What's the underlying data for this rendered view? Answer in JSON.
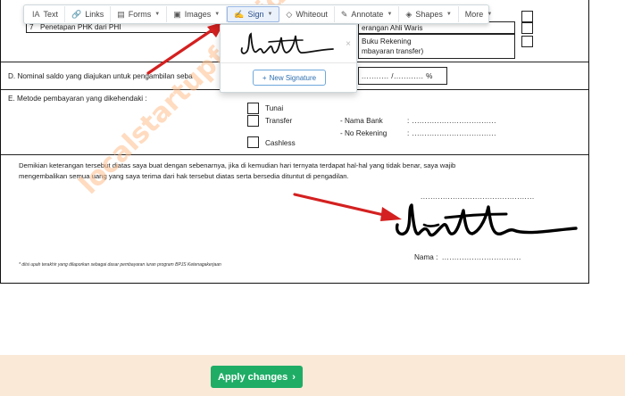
{
  "toolbar": {
    "items": [
      {
        "icon": "text-icon",
        "glyph": "IA",
        "label": "Text",
        "dropdown": false
      },
      {
        "icon": "link-icon",
        "glyph": "🔗",
        "label": "Links",
        "dropdown": false
      },
      {
        "icon": "forms-icon",
        "glyph": "▤",
        "label": "Forms",
        "dropdown": true
      },
      {
        "icon": "images-icon",
        "glyph": "▣",
        "label": "Images",
        "dropdown": true
      },
      {
        "icon": "sign-icon",
        "glyph": "✍",
        "label": "Sign",
        "dropdown": true
      },
      {
        "icon": "whiteout-icon",
        "glyph": "◇",
        "label": "Whiteout",
        "dropdown": false
      },
      {
        "icon": "annotate-icon",
        "glyph": "✎",
        "label": "Annotate",
        "dropdown": true
      },
      {
        "icon": "shapes-icon",
        "glyph": "◈",
        "label": "Shapes",
        "dropdown": true
      },
      {
        "icon": "more-icon",
        "glyph": "",
        "label": "More",
        "dropdown": true
      }
    ]
  },
  "sign_dropdown": {
    "close_glyph": "×",
    "new_signature_label": "New Signature",
    "plus_glyph": "+"
  },
  "document": {
    "row7_number": "7",
    "row7_text": "Penetapan PHK dari PHI",
    "right_col_heir": "erangan Ahli Waris",
    "right_col_bank_1": "Buku Rekening",
    "right_col_bank_2": "mbayaran transfer)",
    "section_d_label": "D. Nominal saldo yang diajukan untuk pengambilan seba",
    "percent_field": "........... /............ %",
    "section_e_label": "E. Metode pembayaran yang dikehendaki :",
    "pay_tunai": "Tunai",
    "pay_transfer": "Transfer",
    "pay_cashless": "Cashless",
    "bank_name_label": "- Nama Bank",
    "bank_name_value": ":  ..................................",
    "account_label": "- No Rekening",
    "account_value": ":  ..................................",
    "declaration_line1": "Demikian keterangan tersebut diatas saya buat dengan sebenarnya, jika di kemudian hari ternyata terdapat hal-hal yang tidak benar, saya wajib",
    "declaration_line2": "mengembalikan semua uang yang saya terima dari hak tersebut diatas serta bersedia dituntut di pengadilan.",
    "date_dots": "..............................................",
    "name_label": "Nama :",
    "name_dots": "................................",
    "footnote": "* diisi upah terakhir yang dilaporkan sebagai dasar pembayaran iuran program BPJS Ketenagakerjaan"
  },
  "watermark": "localstartupfest.id",
  "footer": {
    "apply_label": "Apply changes",
    "apply_glyph": "›"
  },
  "colors": {
    "accent_green": "#1fad66",
    "annotation_red": "#d42020",
    "bottom_bar_bg": "#fbe9d7",
    "link_blue": "#2e6fb0"
  }
}
